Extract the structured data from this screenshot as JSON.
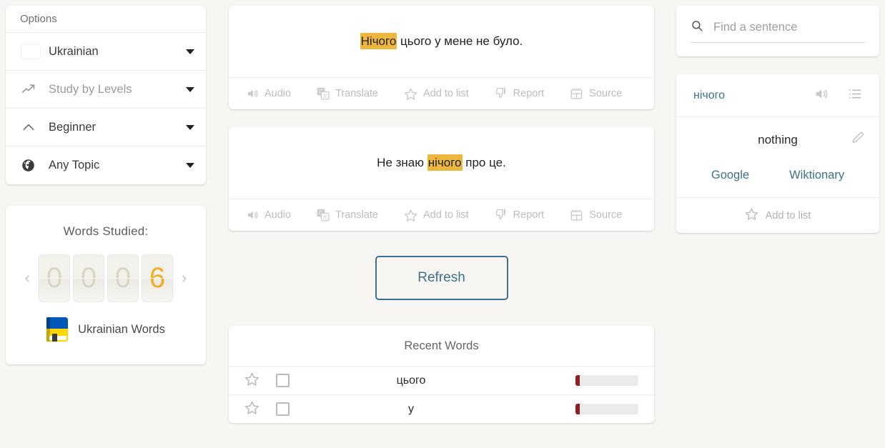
{
  "sidebar": {
    "options_header": "Options",
    "rows": [
      {
        "label": "Ukrainian",
        "icon": "ukraine-flag-icon",
        "muted": false
      },
      {
        "label": "Study by Levels",
        "icon": "trending-up-icon",
        "muted": true
      },
      {
        "label": "Beginner",
        "icon": "chevron-up-icon",
        "muted": false
      },
      {
        "label": "Any Topic",
        "icon": "globe-icon",
        "muted": false
      }
    ],
    "words_studied": {
      "title": "Words Studied:",
      "digits": [
        "0",
        "0",
        "0",
        "6"
      ],
      "active_digit_index": 3,
      "prev_label": "‹",
      "next_label": "›",
      "footer_label": "Ukrainian Words"
    }
  },
  "sentences": [
    {
      "before": "",
      "highlight": "Нічого",
      "after": " цього у мене не було."
    },
    {
      "before": "Не знаю ",
      "highlight": "нічого",
      "after": " про це."
    }
  ],
  "sentence_actions": [
    {
      "label": "Audio",
      "icon": "speaker-icon"
    },
    {
      "label": "Translate",
      "icon": "google-translate-icon"
    },
    {
      "label": "Add to list",
      "icon": "star-icon"
    },
    {
      "label": "Report",
      "icon": "thumbs-down-icon"
    },
    {
      "label": "Source",
      "icon": "newspaper-icon"
    }
  ],
  "refresh_label": "Refresh",
  "recent_words": {
    "title": "Recent Words",
    "rows": [
      {
        "word": "цього",
        "progress": 7
      },
      {
        "word": "у",
        "progress": 7
      }
    ]
  },
  "search": {
    "placeholder": "Find a sentence",
    "value": ""
  },
  "word_panel": {
    "term": "нічого",
    "translation": "nothing",
    "links": [
      {
        "label": "Google"
      },
      {
        "label": "Wiktionary"
      }
    ],
    "add_to_list_label": "Add to list"
  },
  "colors": {
    "background": "#f7f6f2",
    "highlight": "#edb63c",
    "accent_teal": "#3d708c",
    "counter_active": "#f0ad21",
    "progress_fill": "#8f2020",
    "flag_blue": "#0057b7",
    "flag_yellow": "#ffd700"
  }
}
